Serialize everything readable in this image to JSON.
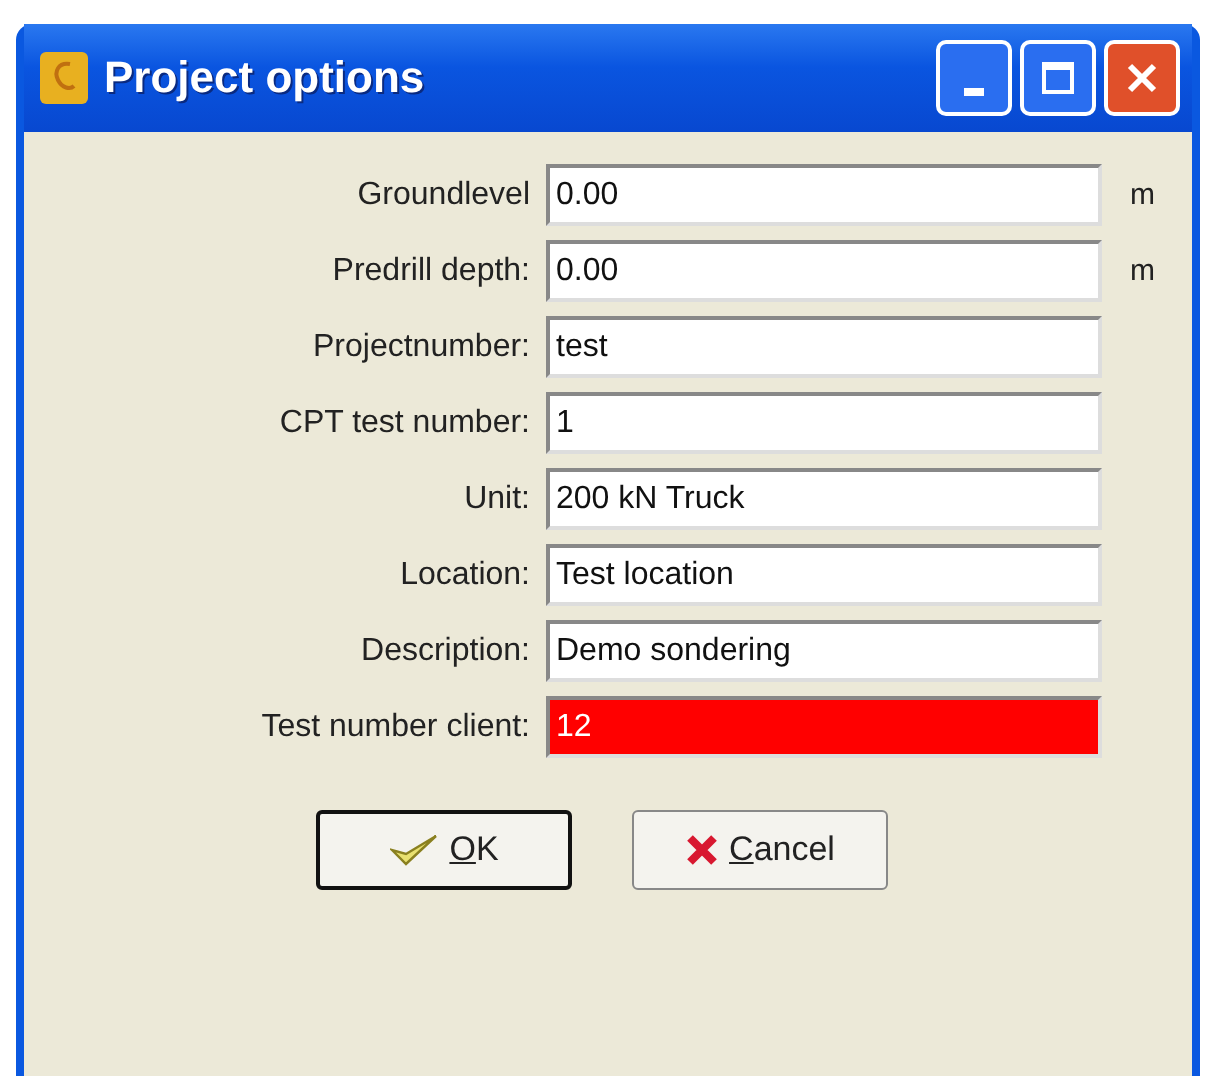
{
  "window": {
    "title": "Project options"
  },
  "fields": [
    {
      "label": "Groundlevel",
      "value": "0.00",
      "unit": "m",
      "error": false
    },
    {
      "label": "Predrill depth:",
      "value": "0.00",
      "unit": "m",
      "error": false
    },
    {
      "label": "Projectnumber:",
      "value": "test",
      "error": false
    },
    {
      "label": "CPT test number:",
      "value": "1",
      "error": false
    },
    {
      "label": "Unit:",
      "value": "200 kN Truck",
      "error": false
    },
    {
      "label": "Location:",
      "value": "Test location",
      "error": false
    },
    {
      "label": "Description:",
      "value": "Demo sondering",
      "error": false
    },
    {
      "label": "Test number client:",
      "value": "12",
      "error": true
    }
  ],
  "buttons": [
    {
      "kind": "ok",
      "accel": "O",
      "rest": "K",
      "default": true
    },
    {
      "kind": "cancel",
      "accel": "C",
      "rest": "ancel",
      "default": false
    }
  ]
}
